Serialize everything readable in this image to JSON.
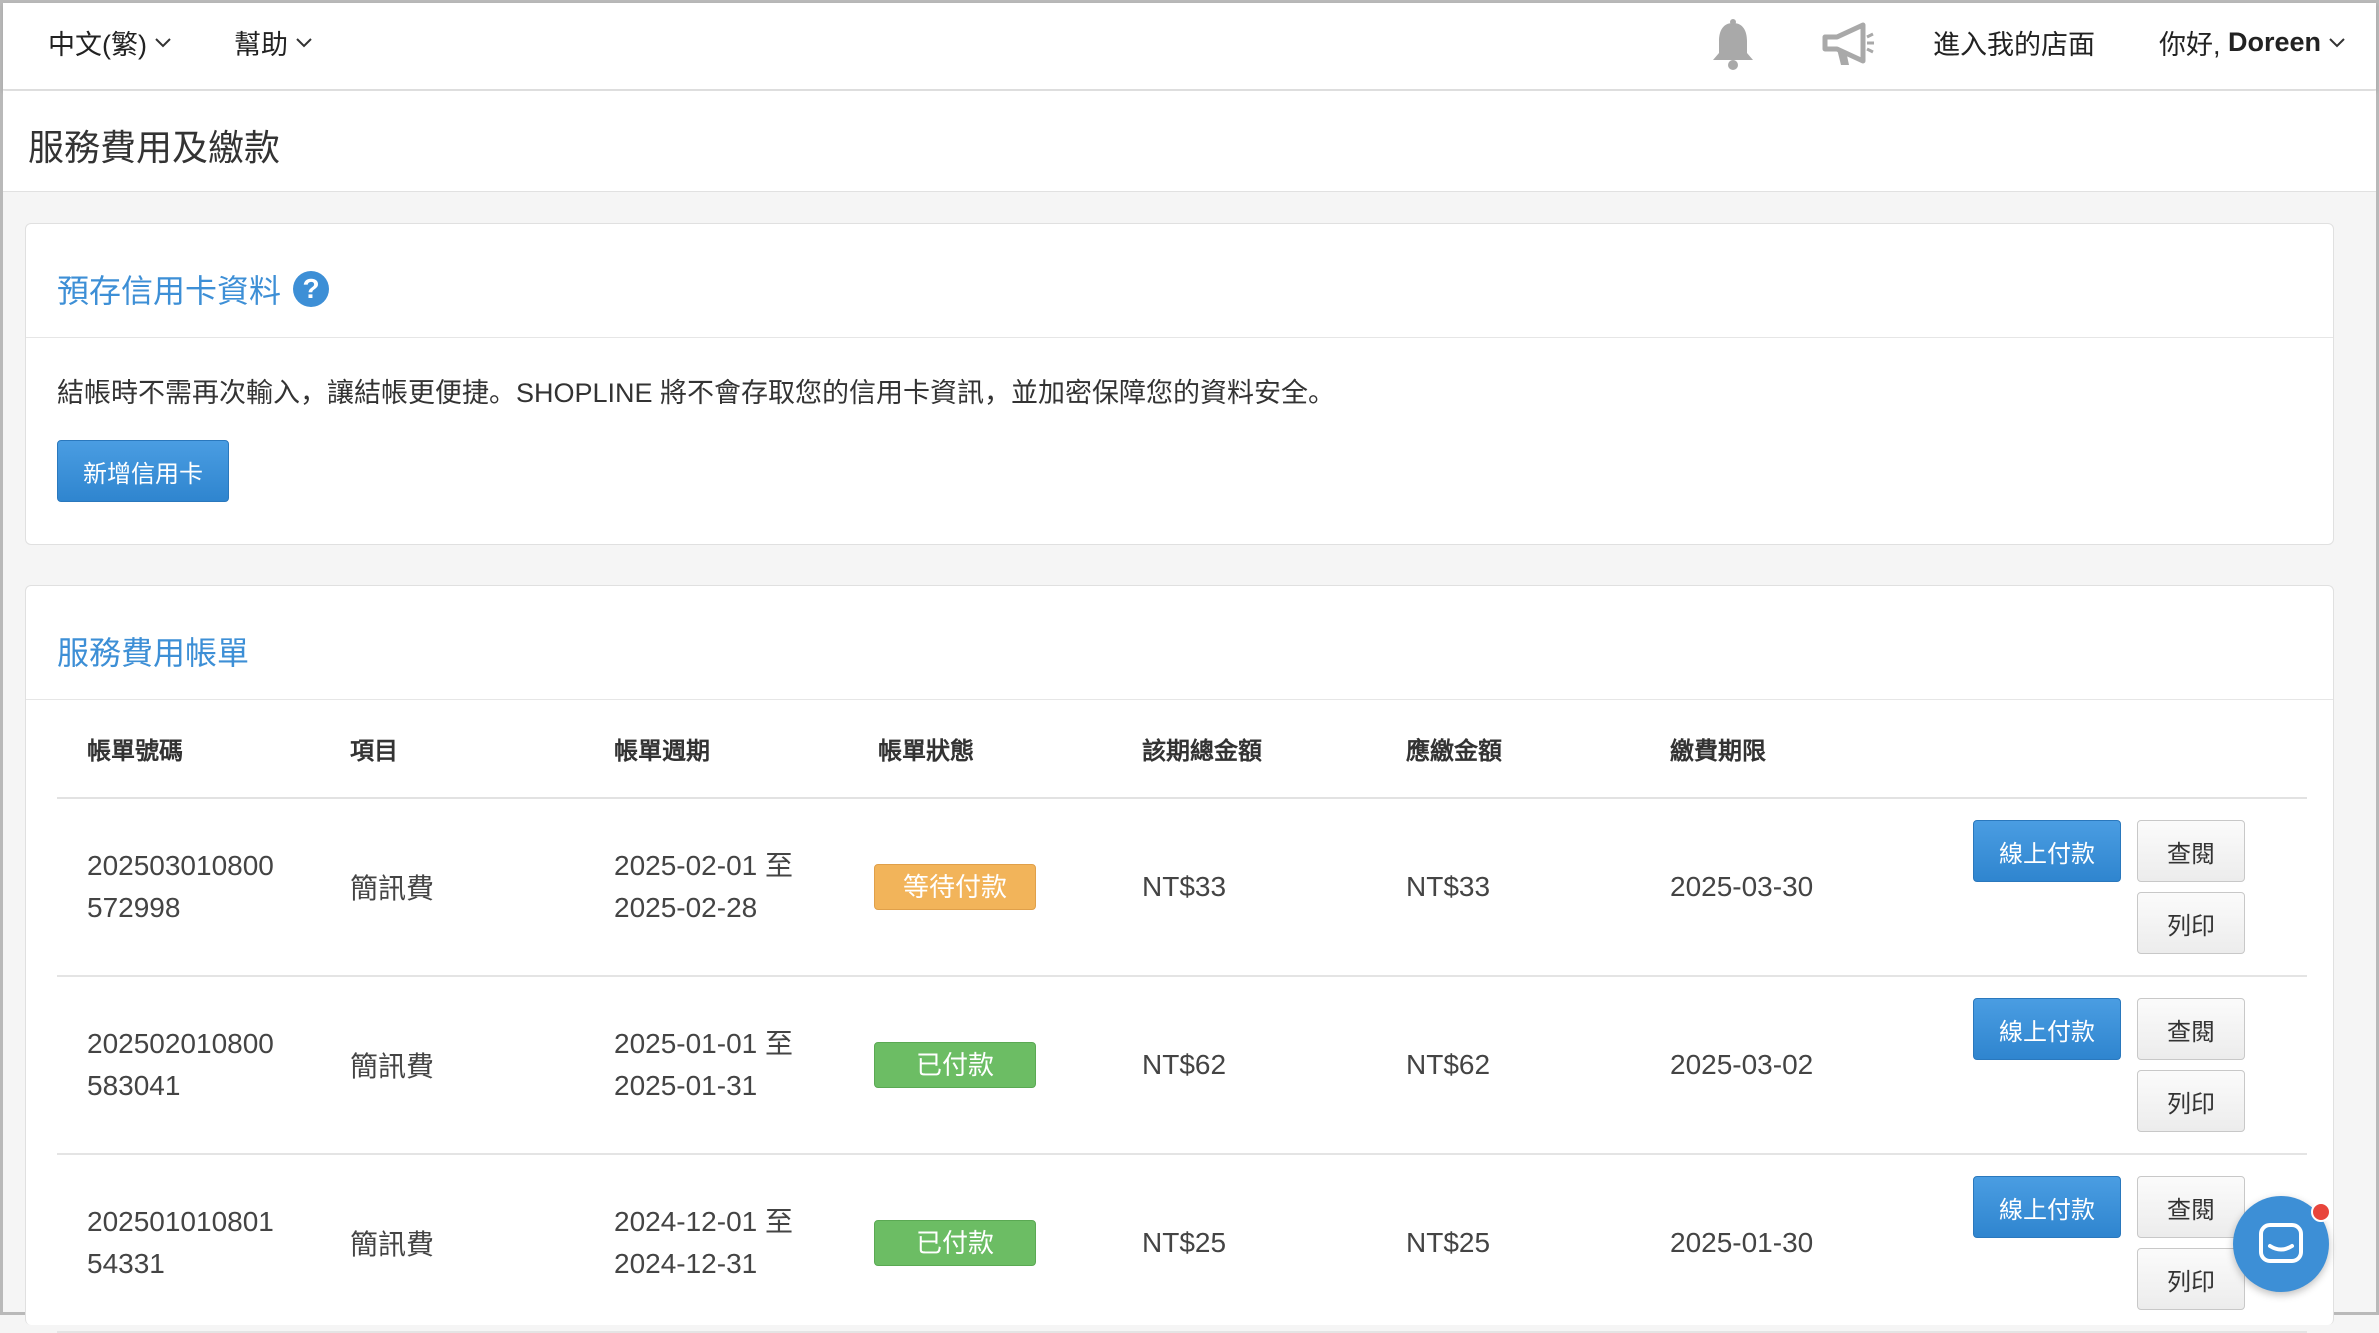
{
  "topbar": {
    "language": "中文(繁)",
    "help": "幫助",
    "storefront": "進入我的店面",
    "greeting": "你好, ",
    "user_name": "Doreen",
    "icons": {
      "notification": "bell-icon",
      "announcement": "megaphone-icon",
      "dropdown": "chevron-down-icon"
    }
  },
  "page": {
    "title": "服務費用及繳款"
  },
  "credit_card": {
    "title": "預存信用卡資料",
    "help_icon": "?",
    "description": "結帳時不需再次輸入，讓結帳更便捷。SHOPLINE 將不會存取您的信用卡資訊，並加密保障您的資料安全。",
    "add_button": "新增信用卡"
  },
  "bills": {
    "title": "服務費用帳單",
    "columns": [
      "帳單號碼",
      "項目",
      "帳單週期",
      "帳單狀態",
      "該期總金額",
      "應繳金額",
      "繳費期限"
    ],
    "rows": [
      {
        "id_line1": "202503010800",
        "id_line2": "572998",
        "item": "簡訊費",
        "period_line1": "2025-02-01 至",
        "period_line2": "2025-02-28",
        "status": "等待付款",
        "status_type": "pending",
        "total": "NT$33",
        "due_amount": "NT$33",
        "due_date": "2025-03-30",
        "pay_label": "線上付款",
        "view_label": "查閱",
        "print_label": "列印"
      },
      {
        "id_line1": "202502010800",
        "id_line2": "583041",
        "item": "簡訊費",
        "period_line1": "2025-01-01 至",
        "period_line2": "2025-01-31",
        "status": "已付款",
        "status_type": "paid",
        "total": "NT$62",
        "due_amount": "NT$62",
        "due_date": "2025-03-02",
        "pay_label": "線上付款",
        "view_label": "查閱",
        "print_label": "列印"
      },
      {
        "id_line1": "202501010801",
        "id_line2": "54331",
        "item": "簡訊費",
        "period_line1": "2024-12-01 至",
        "period_line2": "2024-12-31",
        "status": "已付款",
        "status_type": "paid",
        "total": "NT$25",
        "due_amount": "NT$25",
        "due_date": "2025-01-30",
        "pay_label": "線上付款",
        "view_label": "查閱",
        "print_label": "列印"
      }
    ]
  },
  "colors": {
    "accent": "#3d8fd6",
    "pending": "#f2b45a",
    "paid": "#6cbd64"
  },
  "chat": {
    "icon": "chat-icon"
  }
}
